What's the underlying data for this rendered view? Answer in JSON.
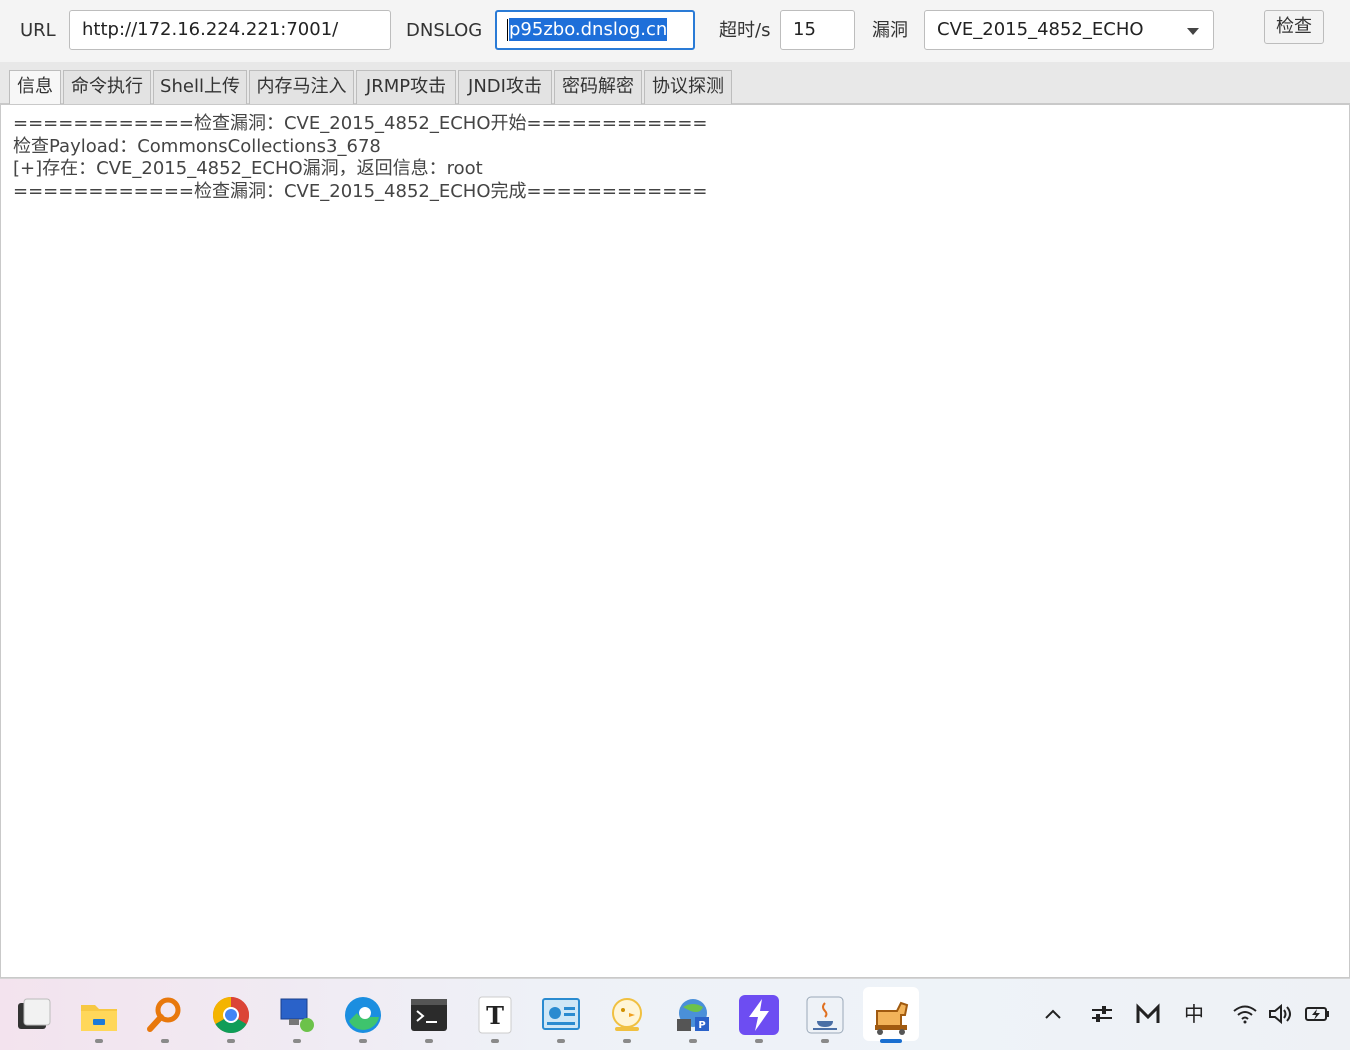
{
  "toolbar": {
    "url_label": "URL",
    "url_value": "http://172.16.224.221:7001/",
    "dnslog_label": "DNSLOG",
    "dnslog_value": "p95zbo.dnslog.cn",
    "timeout_label": "超时/s",
    "timeout_value": "15",
    "vuln_label": "漏洞",
    "vuln_selected": "CVE_2015_4852_ECHO",
    "check_button": "检查"
  },
  "tabs": [
    "信息",
    "命令执行",
    "Shell上传",
    "内存马注入",
    "JRMP攻击",
    "JNDI攻击",
    "密码解密",
    "协议探测"
  ],
  "active_tab": "信息",
  "output": {
    "lines": [
      "============检查漏洞：CVE_2015_4852_ECHO开始============",
      "检查Payload：CommonsCollections3_678",
      "[+]存在：CVE_2015_4852_ECHO漏洞，返回信息：root",
      "============检查漏洞：CVE_2015_4852_ECHO完成============"
    ]
  },
  "taskbar": {
    "apps": [
      "start-icon",
      "file-explorer-icon",
      "search-tool-icon",
      "chrome-icon",
      "remote-desktop-icon",
      "edge-icon",
      "terminal-icon",
      "typora-icon",
      "dashboard-app-icon",
      "chick-app-icon",
      "network-app-icon",
      "lightning-app-icon",
      "java-icon",
      "trojan-horse-app-icon"
    ],
    "tray": {
      "ime": "中"
    }
  },
  "colors": {
    "accent": "#1e6fd9",
    "focus_border": "#2a7bd6",
    "active_indicator": "#1a6fd0"
  }
}
